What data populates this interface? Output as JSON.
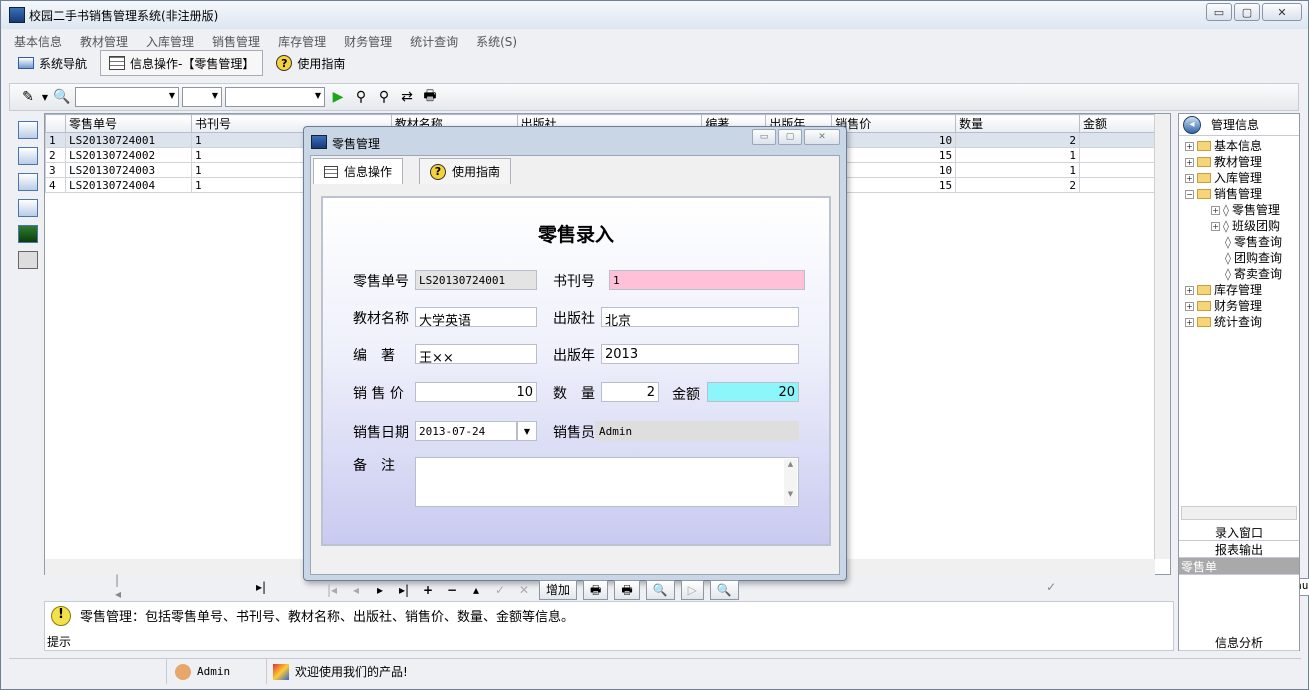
{
  "app": {
    "title": "校园二手书销售管理系统(非注册版)"
  },
  "window_buttons": [
    "▭",
    "▢",
    "✕"
  ],
  "menu": [
    "基本信息",
    "教材管理",
    "入库管理",
    "销售管理",
    "库存管理",
    "财务管理",
    "统计查询",
    "系统(S)"
  ],
  "tabs": [
    {
      "label": "系统导航",
      "icon": "monitor-icon"
    },
    {
      "label": "信息操作-【零售管理】",
      "icon": "grid-icon"
    },
    {
      "label": "使用指南",
      "icon": "help-icon"
    }
  ],
  "grid": {
    "headers": [
      "零售单号",
      "书刊号",
      "教材名称",
      "出版社",
      "编著",
      "出版年",
      "销售价",
      "数量",
      "金额"
    ],
    "rows": [
      {
        "idx": "1",
        "id": "LS20130724001",
        "book": "1",
        "price": "10",
        "qty": "2"
      },
      {
        "idx": "2",
        "id": "LS20130724002",
        "book": "1",
        "price": "15",
        "qty": "1"
      },
      {
        "idx": "3",
        "id": "LS20130724003",
        "book": "1",
        "price": "10",
        "qty": "1"
      },
      {
        "idx": "4",
        "id": "LS20130724004",
        "book": "1",
        "price": "15",
        "qty": "2"
      }
    ]
  },
  "nav_combo": "Default",
  "hint": {
    "text": "零售管理：包括零售单号、书刊号、教材名称、出版社、销售价、数量、金额等信息。",
    "label": "提示"
  },
  "status": {
    "user": "Admin",
    "welcome": "欢迎使用我们的产品!"
  },
  "right_panel": {
    "title": "管理信息",
    "tree": [
      "基本信息",
      "教材管理",
      "入库管理",
      "销售管理",
      "零售管理",
      "班级团购",
      "零售查询",
      "团购查询",
      "寄卖查询",
      "库存管理",
      "财务管理",
      "统计查询"
    ],
    "buttons": [
      "录入窗口",
      "报表输出",
      "零售单",
      "信息分析"
    ]
  },
  "dialog": {
    "title": "零售管理",
    "tabs": [
      "信息操作",
      "使用指南"
    ],
    "form_title": "零售录入",
    "labels": {
      "id": "零售单号",
      "book": "书刊号",
      "name": "教材名称",
      "publisher": "出版社",
      "author": "编　著",
      "year": "出版年",
      "price": "销 售 价",
      "qty": "数　量",
      "amount": "金额",
      "date": "销售日期",
      "seller": "销售员",
      "note": "备　注"
    },
    "values": {
      "id": "LS20130724001",
      "book": "1",
      "name": "大学英语",
      "publisher": "北京",
      "author": "王××",
      "year": "2013",
      "price": "10",
      "qty": "2",
      "amount": "20",
      "date": "2013-07-24",
      "seller": "Admin",
      "note": ""
    },
    "nav_buttons": {
      "add": "增加"
    }
  },
  "colors": {
    "book_field": "#ffc0d8",
    "amount_field": "#8cf6fa"
  }
}
